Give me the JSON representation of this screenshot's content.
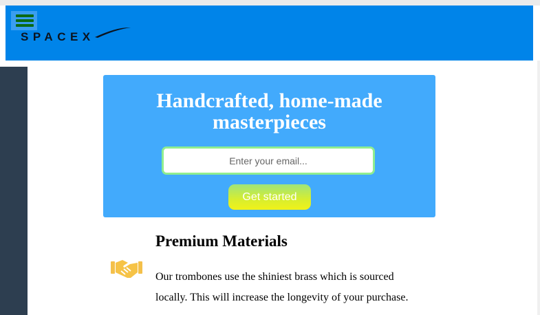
{
  "header": {
    "logo_text": "SPACEX",
    "background_color": "#0084e9",
    "menu_icon": "hamburger-menu-icon"
  },
  "hero": {
    "title": "Handcrafted, home-made masterpieces",
    "email_placeholder": "Enter your email...",
    "cta_label": "Get started",
    "background_color": "#42aafc"
  },
  "feature": {
    "icon": "handshake-icon",
    "title": "Premium Materials",
    "text": "Our trombones use the shiniest brass which is sourced locally. This will increase the longevity of your purchase."
  }
}
